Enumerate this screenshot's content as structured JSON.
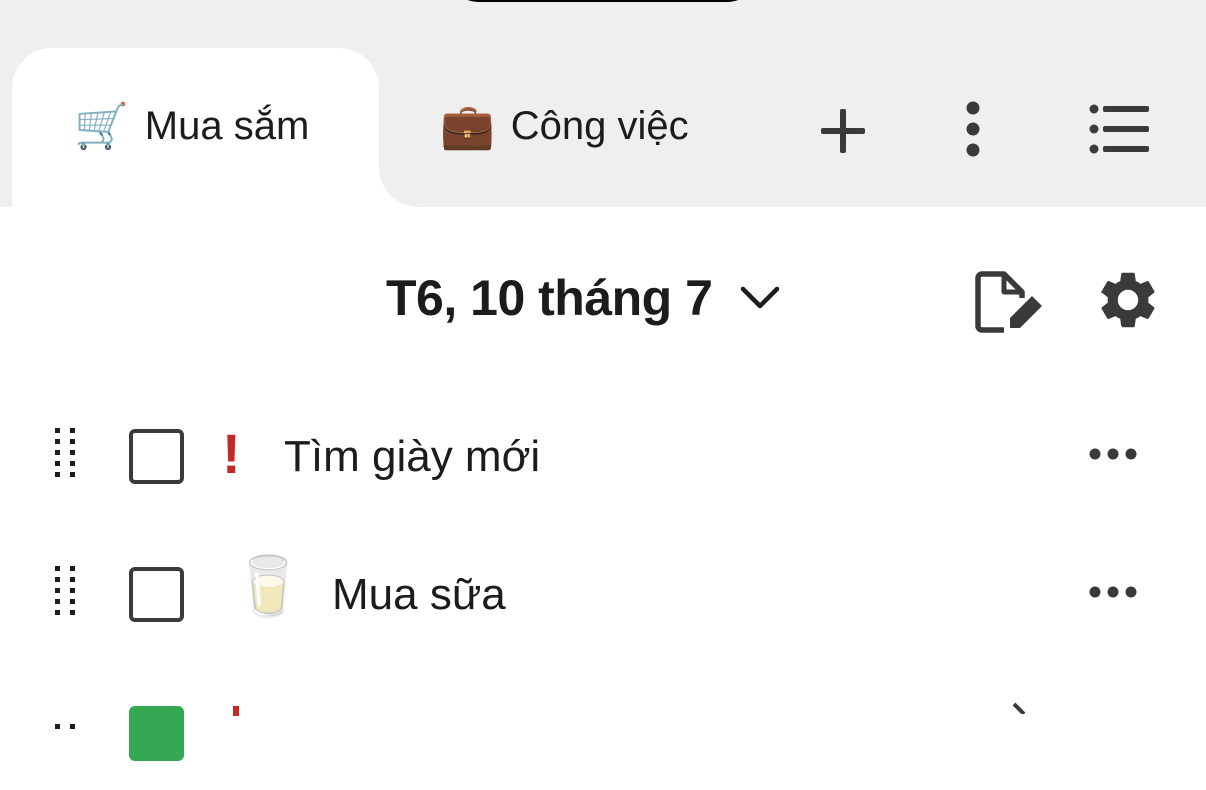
{
  "tabs": [
    {
      "emoji": "🛒",
      "label": "Mua sắm",
      "active": true
    },
    {
      "emoji": "💼",
      "label": "Công việc",
      "active": false
    }
  ],
  "toolbar": {
    "add_icon": "plus-icon",
    "more_icon": "vertical-dots-icon",
    "list_icon": "list-icon"
  },
  "header": {
    "date": "T6, 10 tháng 7",
    "chevron_icon": "chevron-down-icon",
    "edit_icon": "edit-note-icon",
    "settings_icon": "gear-icon"
  },
  "tasks": [
    {
      "title": "Tìm giày mới",
      "priority": "!",
      "emoji": "",
      "checked": false
    },
    {
      "title": "Mua sữa",
      "priority": "",
      "emoji": "🥛",
      "checked": false
    }
  ],
  "colors": {
    "topbar_bg": "#efefef",
    "text": "#1c1c1e",
    "priority": "#c62828",
    "checkbox_border": "#3b3b3e",
    "accent_green": "#34a853"
  }
}
